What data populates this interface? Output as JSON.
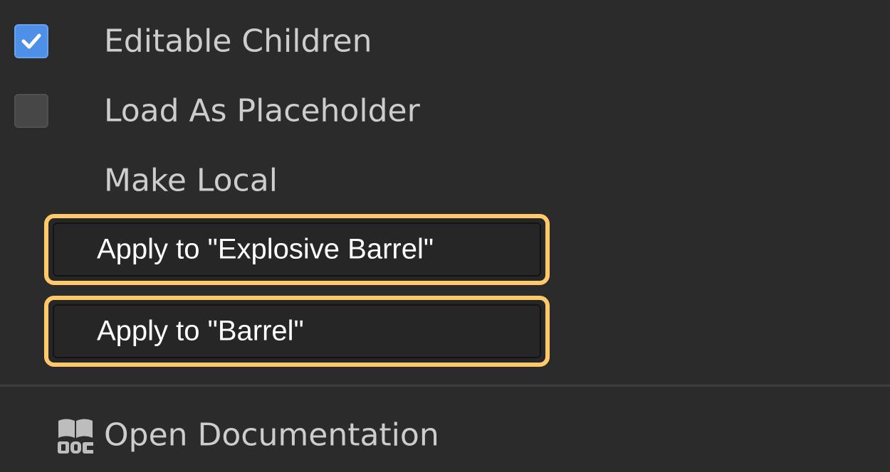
{
  "menu": {
    "items": [
      {
        "label": "Editable Children",
        "checked": true
      },
      {
        "label": "Load As Placeholder",
        "checked": false
      },
      {
        "label": "Make Local"
      }
    ],
    "apply_items": [
      {
        "label": "Apply to \"Explosive Barrel\""
      },
      {
        "label": "Apply to \"Barrel\""
      }
    ],
    "documentation": {
      "label": "Open Documentation",
      "icon": "doc-book-icon"
    }
  },
  "colors": {
    "background": "#2b2b2b",
    "checkbox_checked": "#4e8fe8",
    "checkbox_unchecked": "#474747",
    "highlight": "#ffc96b",
    "text": "#cdcdcd"
  }
}
